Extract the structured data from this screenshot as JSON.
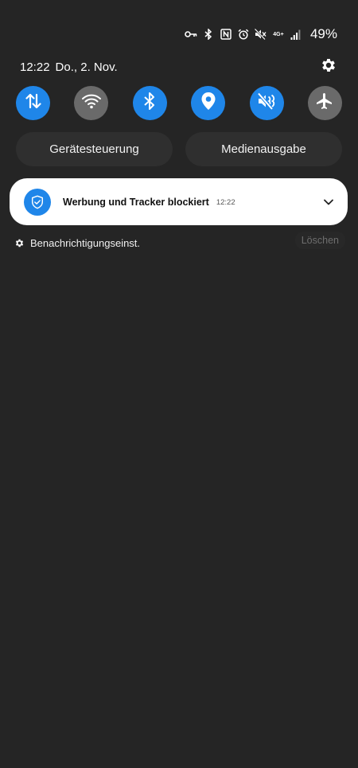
{
  "status_bar": {
    "icons": [
      "vpn-key-icon",
      "bluetooth-icon",
      "nfc-icon",
      "alarm-icon",
      "mute-icon",
      "4g-plus-icon",
      "signal-icon"
    ],
    "network_type": "4G+",
    "battery": "49%"
  },
  "header": {
    "time": "12:22",
    "date": "Do., 2. Nov.",
    "settings_icon": "gear-icon"
  },
  "quick_settings": [
    {
      "name": "mobile-data",
      "icon": "arrows-up-down-icon",
      "state": "on"
    },
    {
      "name": "wifi",
      "icon": "wifi-icon",
      "state": "off"
    },
    {
      "name": "bluetooth",
      "icon": "bluetooth-icon",
      "state": "on"
    },
    {
      "name": "location",
      "icon": "location-pin-icon",
      "state": "on"
    },
    {
      "name": "sound",
      "icon": "mute-icon",
      "state": "on"
    },
    {
      "name": "airplane-mode",
      "icon": "airplane-icon",
      "state": "off"
    }
  ],
  "pills": {
    "devices": "Gerätesteuerung",
    "media": "Medienausgabe"
  },
  "notification": {
    "icon": "shield-check-icon",
    "title": "Werbung und Tracker blockiert",
    "time": "12:22"
  },
  "footer": {
    "settings_label": "Benachrichtigungseinst.",
    "clear_label": "Löschen"
  },
  "colors": {
    "background": "#252525",
    "accent": "#1f86e9",
    "toggle_off": "#6a6a6a",
    "pill": "#2f2f2f",
    "card": "#ffffff"
  }
}
